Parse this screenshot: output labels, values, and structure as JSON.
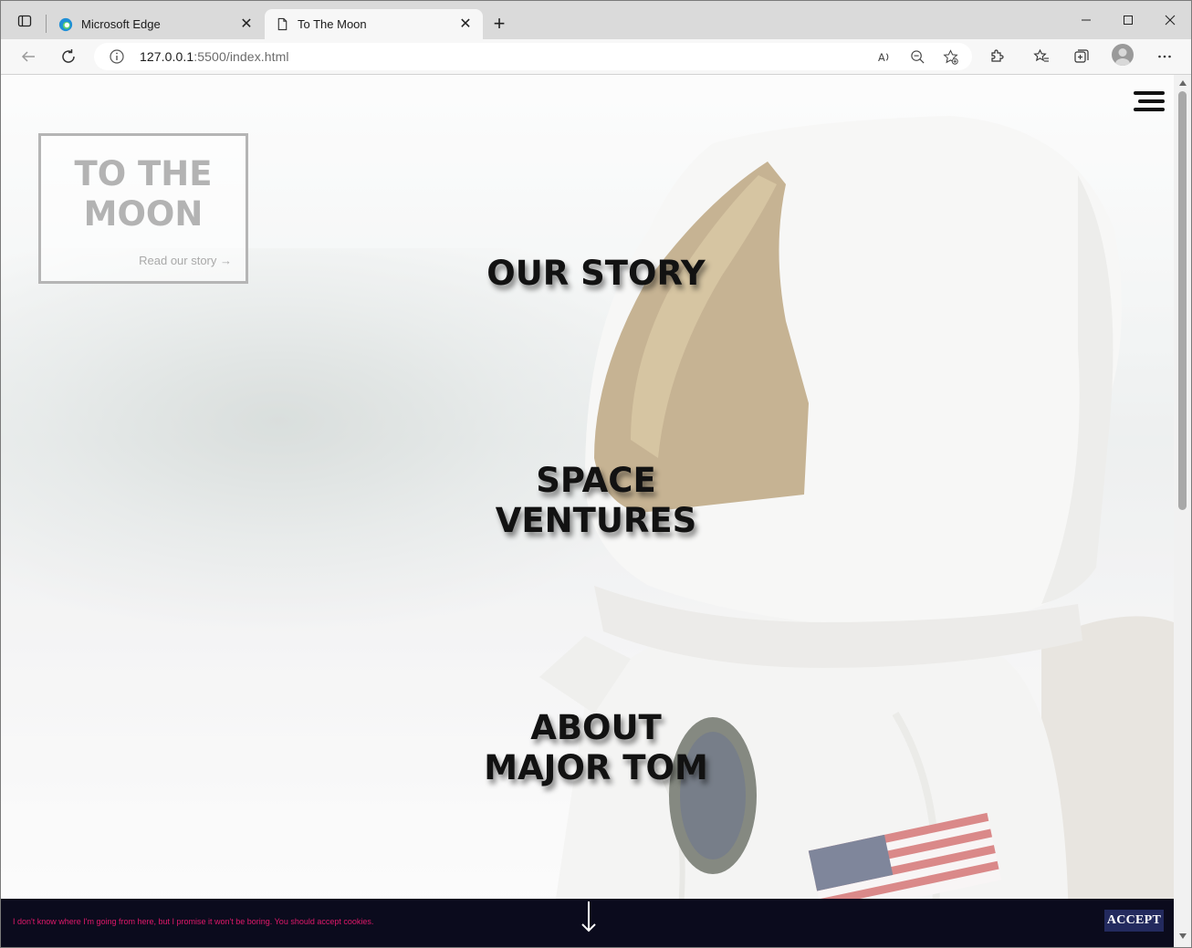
{
  "browser": {
    "tabs": [
      {
        "title": "Microsoft Edge",
        "icon": "edge-logo-icon",
        "active": false
      },
      {
        "title": "To The Moon",
        "icon": "page-icon",
        "active": true
      }
    ],
    "new_tab_label": "+",
    "address": {
      "host": "127.0.0.1",
      "rest": ":5500/index.html"
    }
  },
  "page": {
    "brand": {
      "title": "TO THE\nMOON",
      "link": "Read our story →"
    },
    "nav": [
      {
        "label": "OUR STORY"
      },
      {
        "label": "SPACE\nVENTURES"
      },
      {
        "label": "ABOUT\nMAJOR TOM"
      }
    ],
    "cookie": {
      "text": "I don't know where I'm going from here, but I promise it won't be boring. You should accept cookies.",
      "accept_label": "ACCEPT"
    }
  },
  "colors": {
    "cookie_bg": "#0b0b1d",
    "cookie_text": "#e0186a",
    "accept_bg": "#232a5e",
    "nav_text": "#121212",
    "brand_text": "#b3b3b3"
  }
}
